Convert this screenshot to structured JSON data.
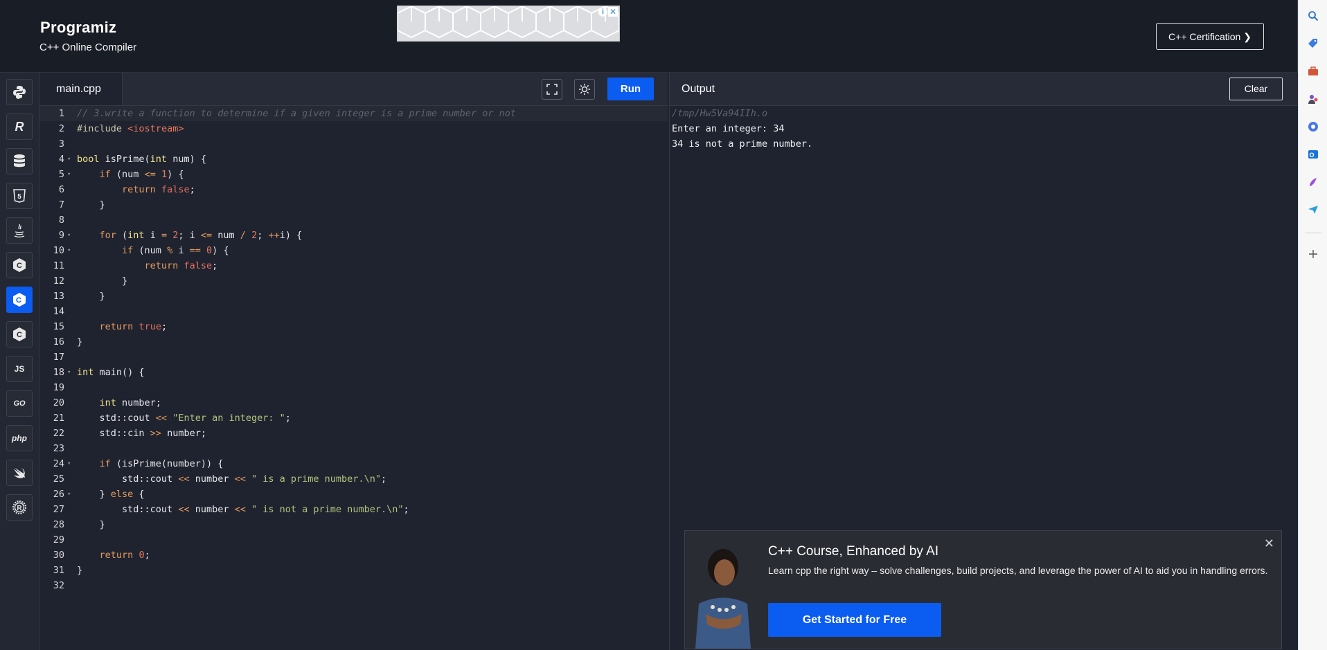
{
  "header": {
    "logo": "Programiz",
    "subtitle": "C++ Online Compiler",
    "cert_button": "C++ Certification ❯",
    "ad_info": "i",
    "ad_close": "✕"
  },
  "sidebar": {
    "items": [
      {
        "label": "python",
        "glyph": ""
      },
      {
        "label": "r",
        "glyph": "R"
      },
      {
        "label": "sql",
        "glyph": ""
      },
      {
        "label": "html",
        "glyph": "5"
      },
      {
        "label": "java",
        "glyph": ""
      },
      {
        "label": "c",
        "glyph": "C"
      },
      {
        "label": "cpp",
        "glyph": "C"
      },
      {
        "label": "csharp",
        "glyph": "C"
      },
      {
        "label": "js",
        "glyph": "JS"
      },
      {
        "label": "go",
        "glyph": "GO"
      },
      {
        "label": "php",
        "glyph": "php"
      },
      {
        "label": "swift",
        "glyph": ""
      },
      {
        "label": "rust",
        "glyph": "R"
      }
    ]
  },
  "editor": {
    "tab": "main.cpp",
    "run_label": "Run",
    "lines": [
      "// 3.write a function to determine if a given integer is a prime number or not",
      "#include <iostream>",
      "",
      "bool isPrime(int num) {",
      "    if (num <= 1) {",
      "        return false;",
      "    }",
      "",
      "    for (int i = 2; i <= num / 2; ++i) {",
      "        if (num % i == 0) {",
      "            return false;",
      "        }",
      "    }",
      "",
      "    return true;",
      "}",
      "",
      "int main() {",
      "",
      "    int number;",
      "    std::cout << \"Enter an integer: \";",
      "    std::cin >> number;",
      "",
      "    if (isPrime(number)) {",
      "        std::cout << number << \" is a prime number.\\n\";",
      "    } else {",
      "        std::cout << number << \" is not a prime number.\\n\";",
      "    }",
      "",
      "    return 0;",
      "}",
      ""
    ]
  },
  "output": {
    "title": "Output",
    "clear_label": "Clear",
    "lines": [
      "/tmp/Hw5Va94IIh.o",
      "Enter an integer: 34",
      "34 is not a prime number."
    ]
  },
  "course": {
    "title": "C++ Course, Enhanced by AI",
    "description": "Learn cpp the right way – solve challenges, build projects, and leverage the power of AI to aid you in handling errors.",
    "button": "Get Started for Free",
    "close": "✕"
  },
  "colors": {
    "accent": "#0b5cf0",
    "background": "#1f2330",
    "header": "#191d26"
  }
}
